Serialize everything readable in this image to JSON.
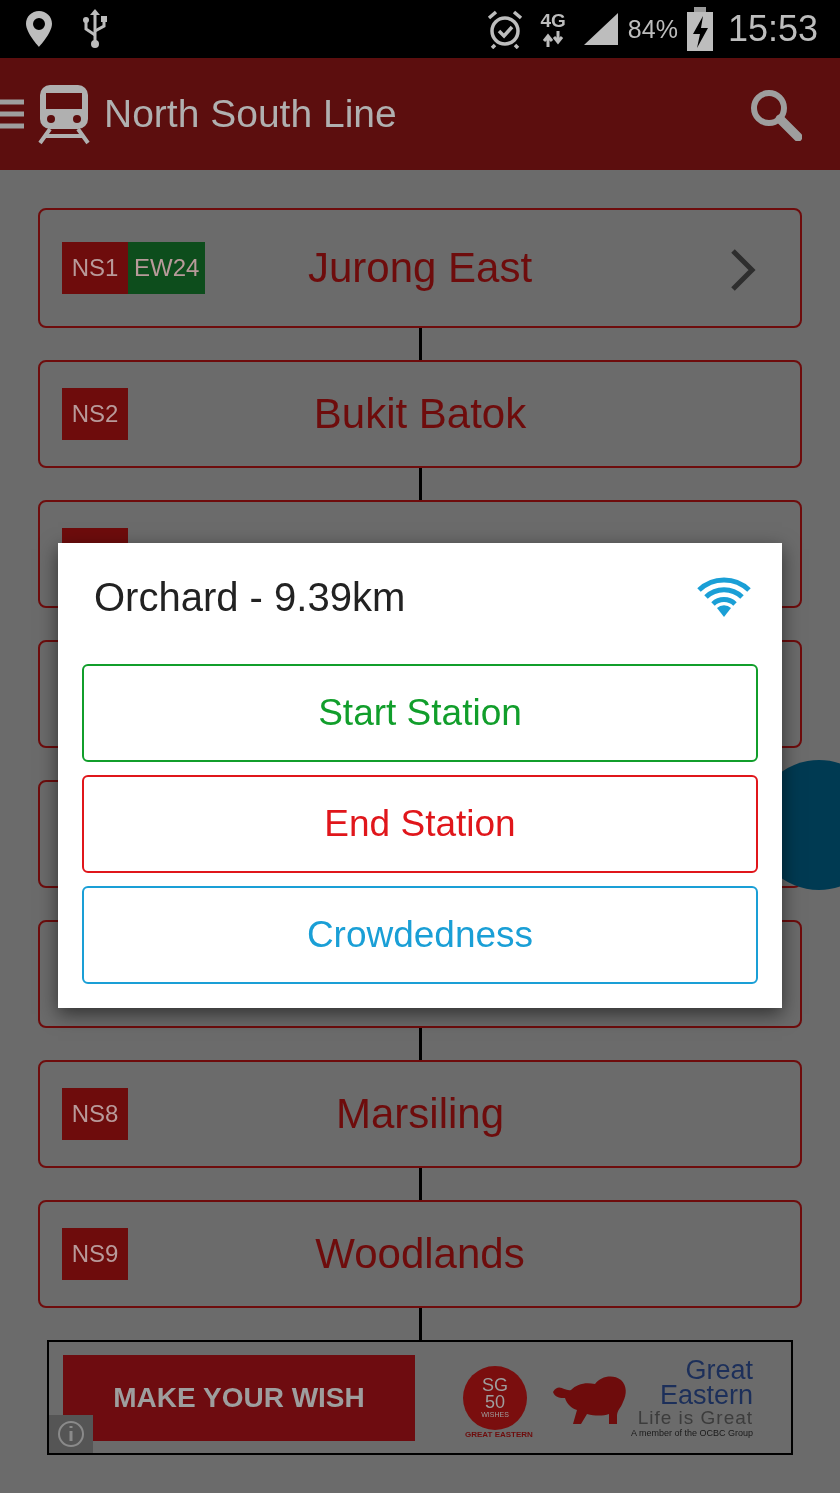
{
  "status_bar": {
    "network": "4G",
    "battery": "84%",
    "time": "15:53"
  },
  "app_bar": {
    "title": "North South Line"
  },
  "stations": [
    {
      "name": "Jurong East",
      "chevron": true,
      "badges": [
        {
          "code": "NS1",
          "color": "#6e0c0c"
        },
        {
          "code": "EW24",
          "color": "#0d4d1c"
        }
      ]
    },
    {
      "name": "Bukit Batok",
      "chevron": false,
      "badges": [
        {
          "code": "NS2",
          "color": "#6e0c0c"
        }
      ]
    },
    {
      "chevron": false,
      "badges": [
        {
          "color": "#6e0c0c"
        }
      ]
    },
    {
      "chevron": false
    },
    {
      "chevron": false
    },
    {
      "chevron": false
    },
    {
      "name": "Marsiling",
      "chevron": false,
      "badges": [
        {
          "code": "NS8",
          "color": "#6e0c0c"
        }
      ]
    },
    {
      "name": "Woodlands",
      "chevron": false,
      "badges": [
        {
          "code": "NS9",
          "color": "#6e0c0c"
        }
      ]
    }
  ],
  "dialog": {
    "title": "Orchard - 9.39km",
    "buttons": [
      {
        "label": "Start Station",
        "color": "#119e2b"
      },
      {
        "label": "End Station",
        "color": "#e0161b"
      },
      {
        "label": "Crowdedness",
        "color": "#1a9fd6"
      }
    ]
  },
  "ad": {
    "cta": "MAKE YOUR WISH",
    "emblem": [
      "SG",
      "50"
    ],
    "emblem_small": "WISHES",
    "emblem_caption": "GREAT EASTERN",
    "brand": [
      "Great",
      "Eastern"
    ],
    "tagline": "Life is Great",
    "note": "A member of the OCBC Group"
  }
}
